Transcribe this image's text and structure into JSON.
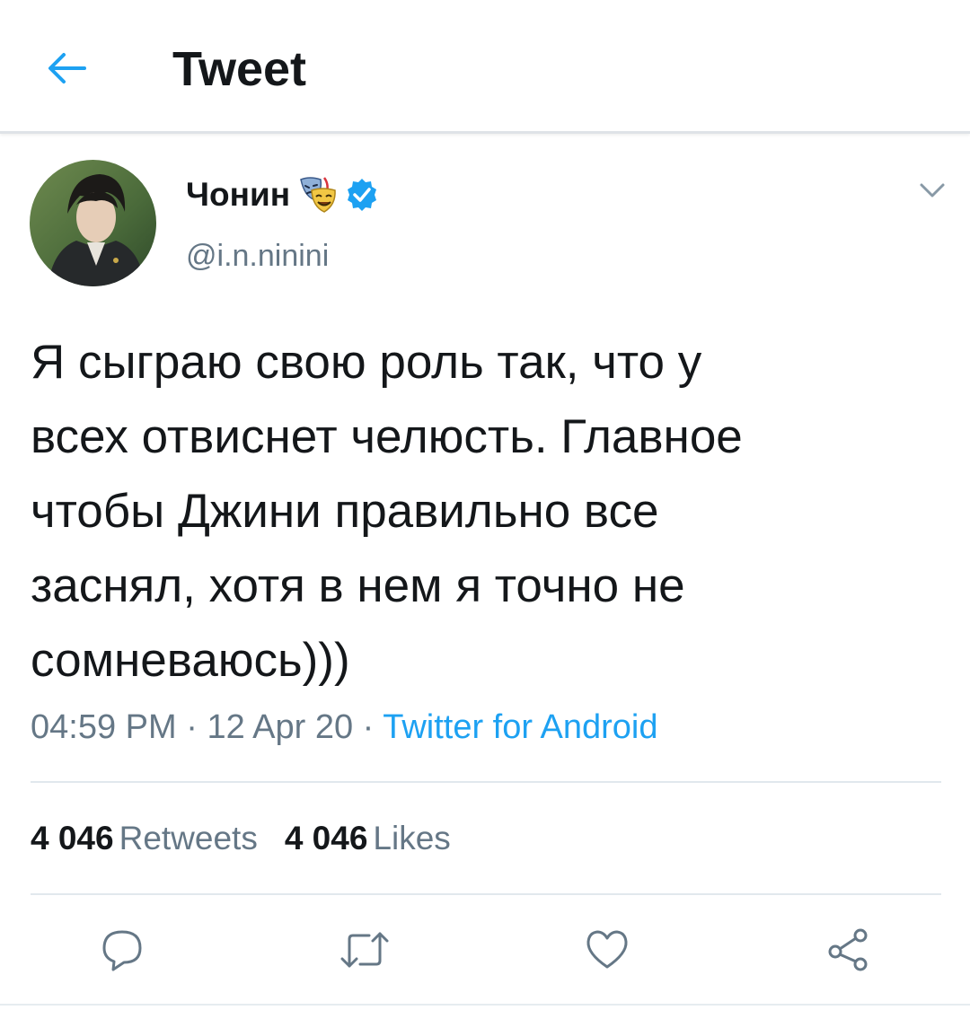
{
  "header": {
    "back_icon": "arrow-left-icon",
    "title": "Tweet"
  },
  "tweet": {
    "author_name": "Чонин",
    "author_emoji": "performing-arts-emoji",
    "verified_icon": "verified-badge-icon",
    "handle": "@i.n.ninini",
    "menu_icon": "chevron-down-icon",
    "text": "Я сыграю свою роль так, что у\nвсех отвиснет челюсть. Главное\nчтобы Джини правильно все\nзаснял, хотя в нем я точно не\nсомневаюсь)))",
    "time": "04:59 PM",
    "separator": " · ",
    "date": "12 Apr 20",
    "source": "Twitter for Android"
  },
  "stats": {
    "retweets_count": "4 046",
    "retweets_label": "Retweets",
    "likes_count": "4 046",
    "likes_label": "Likes"
  },
  "actions": [
    {
      "icon": "reply-icon"
    },
    {
      "icon": "retweet-icon"
    },
    {
      "icon": "like-icon"
    },
    {
      "icon": "share-icon"
    }
  ],
  "colors": {
    "accent": "#1da1f2",
    "text_primary": "#14171a",
    "text_secondary": "#657786",
    "divider": "#e1e8ed",
    "icon_gray": "#657786"
  }
}
